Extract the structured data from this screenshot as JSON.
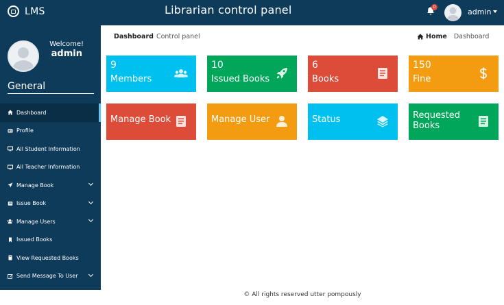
{
  "app": {
    "logo_text": "LMS",
    "title": "Librarian control panel"
  },
  "topbar": {
    "notification_count": "0",
    "user_name": "admin"
  },
  "sidebar": {
    "welcome": "Welcome!",
    "user_name": "admin",
    "section_title": "General",
    "items": [
      {
        "label": "Dashboard",
        "icon": "dashboard-icon",
        "active": true,
        "has_submenu": false
      },
      {
        "label": "Profile",
        "icon": "id-card-icon",
        "active": false,
        "has_submenu": false
      },
      {
        "label": "All Student Information",
        "icon": "monitor-icon",
        "active": false,
        "has_submenu": false
      },
      {
        "label": "All Teacher Information",
        "icon": "monitor-icon",
        "active": false,
        "has_submenu": false
      },
      {
        "label": "Manage Book",
        "icon": "paper-plane-icon",
        "active": false,
        "has_submenu": true
      },
      {
        "label": "Issue Book",
        "icon": "issue-icon",
        "active": false,
        "has_submenu": true
      },
      {
        "label": "Manage Users",
        "icon": "users-icon",
        "active": false,
        "has_submenu": true
      },
      {
        "label": "Issued Books",
        "icon": "bookmark-icon",
        "active": false,
        "has_submenu": false
      },
      {
        "label": "View Requested Books",
        "icon": "book-icon",
        "active": false,
        "has_submenu": false
      },
      {
        "label": "Send Message To User",
        "icon": "edit-icon",
        "active": false,
        "has_submenu": true
      }
    ]
  },
  "breadcrumb": {
    "page": "Dashboard",
    "subtitle": "Control panel",
    "home": "Home",
    "current": "Dashboard"
  },
  "tiles": {
    "members": {
      "count": "9",
      "label": "Members",
      "color": "#00c0ef",
      "icon": "users-icon"
    },
    "issued": {
      "count": "10",
      "label": "Issued Books",
      "color": "#00a65a",
      "icon": "rocket-icon"
    },
    "books": {
      "count": "6",
      "label": "Books",
      "color": "#dd4b39",
      "icon": "book-icon"
    },
    "fine": {
      "count": "150",
      "label": "Fine",
      "color": "#f39c12",
      "icon": "dollar-icon"
    },
    "manage_book": {
      "label": "Manage Book",
      "color": "#dd4b39",
      "icon": "book-icon"
    },
    "manage_user": {
      "label": "Manage User",
      "color": "#f39c12",
      "icon": "user-icon"
    },
    "status": {
      "label": "Status",
      "color": "#00c0ef",
      "icon": "layers-icon"
    },
    "requested": {
      "label_line1": "Requested",
      "label_line2": "Books",
      "color": "#00a65a",
      "icon": "book-icon"
    }
  },
  "footer": {
    "text": "© All rights reserved utter pompously"
  }
}
